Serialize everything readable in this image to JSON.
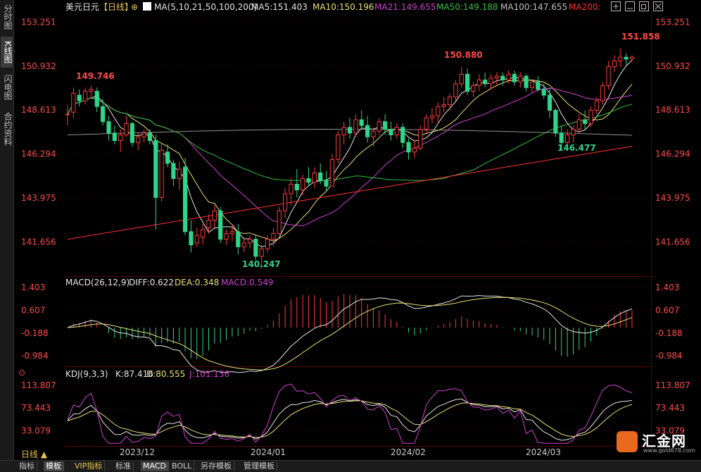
{
  "left_rail": {
    "tabs": [
      {
        "label": "分时图",
        "active": false
      },
      {
        "label": "K线图",
        "active": true
      },
      {
        "label": "闪电图",
        "active": false
      },
      {
        "label": "合约资料",
        "active": false
      }
    ]
  },
  "header": {
    "symbol": "美元日元",
    "period": "【日线】",
    "ma_title": "MA(5,10,21,50,100,200)",
    "ma5": "MA5:151.403",
    "ma10": "MA10:150.196",
    "ma21": "MA21:149.655",
    "ma50": "MA50:149.188",
    "ma100": "MA100:147.655",
    "ma200": "MA200:"
  },
  "window_buttons": [
    "move-icon",
    "minimize-icon",
    "restore-icon",
    "close-icon"
  ],
  "colors": {
    "up": "#ff3b3b",
    "down": "#2fd58a",
    "ma5": "#e6e6e6",
    "ma10": "#e8e070",
    "ma21": "#d040d0",
    "ma50": "#30c040",
    "ma100": "#909090",
    "ma200": "#ff3030",
    "axis_price": "#ff4a4a",
    "grid": "#3a0000"
  },
  "price_panel": {
    "y_ticks": [
      "153.251",
      "150.932",
      "148.613",
      "146.294",
      "143.975",
      "141.656"
    ],
    "annotations": {
      "high_right": "151.858",
      "mid_high": "150.880",
      "early_high": "149.746",
      "low": "140.247",
      "mid_low": "146.477"
    }
  },
  "macd_panel": {
    "title": "MACD(26,12,9)",
    "diff": "DIFF:0.622",
    "dea": "DEA:0.348",
    "macd": "MACD:0.549",
    "y_ticks": [
      "1.403",
      "0.607",
      "-0.188",
      "-0.984"
    ]
  },
  "kdj_panel": {
    "title": "KDJ(9,3,3)",
    "k": "K:87.416",
    "d": "D:80.555",
    "j": "J:101.136",
    "y_ticks": [
      "113.807",
      "73.443",
      "33.079"
    ]
  },
  "x_axis": {
    "labels": [
      "2023/12",
      "2024/01",
      "2024/02",
      "2024/03"
    ]
  },
  "period_label": "日线 ▲",
  "bottom_tabs": [
    {
      "label": "指标",
      "active": false
    },
    {
      "label": "模板",
      "active": true
    },
    {
      "label": "VIP指标",
      "active": false
    },
    {
      "label": "标准",
      "active": false
    },
    {
      "label": "MACD",
      "active": true
    },
    {
      "label": "BOLL",
      "active": false
    },
    {
      "label": "另存模板",
      "active": false
    },
    {
      "label": "管理模板",
      "active": false
    }
  ],
  "logo": {
    "name": "汇金网",
    "sub": "www.gold678.com"
  },
  "chart_data": [
    {
      "type": "candlestick",
      "title": "美元日元【日线】",
      "ylim": [
        140.0,
        153.6
      ],
      "candles": [
        [
          148.4,
          148.9,
          147.8,
          148.4
        ],
        [
          148.5,
          149.8,
          148.2,
          149.5
        ],
        [
          149.4,
          149.7,
          148.8,
          149.1
        ],
        [
          149.1,
          149.8,
          148.9,
          149.6
        ],
        [
          149.6,
          149.9,
          149.2,
          149.7
        ],
        [
          149.6,
          149.8,
          148.5,
          148.8
        ],
        [
          148.8,
          149.2,
          147.8,
          148.0
        ],
        [
          148.0,
          148.3,
          147.0,
          147.4
        ],
        [
          147.4,
          147.8,
          146.8,
          147.0
        ],
        [
          147.0,
          147.6,
          146.4,
          147.3
        ],
        [
          147.3,
          148.3,
          147.2,
          147.9
        ],
        [
          147.9,
          148.0,
          146.7,
          146.9
        ],
        [
          146.9,
          147.4,
          146.5,
          147.2
        ],
        [
          147.2,
          147.6,
          146.9,
          147.4
        ],
        [
          147.4,
          147.6,
          146.8,
          147.0
        ],
        [
          147.0,
          147.3,
          142.3,
          144.0
        ],
        [
          144.0,
          146.9,
          143.8,
          146.5
        ],
        [
          146.4,
          146.8,
          145.6,
          145.8
        ],
        [
          145.8,
          146.0,
          144.6,
          145.0
        ],
        [
          145.0,
          145.9,
          144.4,
          145.5
        ],
        [
          145.6,
          146.1,
          142.0,
          142.2
        ],
        [
          142.2,
          142.8,
          141.1,
          141.5
        ],
        [
          141.6,
          142.4,
          141.4,
          142.0
        ],
        [
          141.9,
          142.6,
          141.5,
          142.3
        ],
        [
          142.4,
          143.1,
          142.1,
          142.8
        ],
        [
          142.8,
          143.6,
          142.4,
          143.3
        ],
        [
          143.3,
          143.5,
          141.6,
          141.8
        ],
        [
          141.8,
          142.3,
          141.5,
          142.1
        ],
        [
          142.1,
          142.6,
          141.7,
          142.2
        ],
        [
          142.2,
          142.6,
          141.0,
          141.4
        ],
        [
          141.4,
          141.9,
          141.1,
          141.6
        ],
        [
          141.6,
          142.0,
          141.3,
          141.8
        ],
        [
          141.8,
          142.0,
          140.7,
          140.9
        ],
        [
          140.9,
          141.5,
          140.25,
          141.3
        ],
        [
          141.3,
          142.0,
          141.1,
          141.8
        ],
        [
          141.8,
          142.4,
          141.4,
          142.1
        ],
        [
          142.1,
          143.5,
          142.0,
          143.3
        ],
        [
          143.3,
          144.5,
          142.9,
          144.2
        ],
        [
          144.2,
          145.0,
          143.6,
          144.7
        ],
        [
          144.7,
          145.5,
          144.0,
          144.4
        ],
        [
          144.4,
          145.2,
          144.1,
          145.0
        ],
        [
          145.0,
          145.6,
          144.6,
          144.8
        ],
        [
          144.8,
          145.6,
          144.5,
          145.3
        ],
        [
          145.3,
          145.8,
          144.7,
          144.9
        ],
        [
          144.9,
          145.4,
          144.3,
          144.6
        ],
        [
          144.6,
          146.3,
          144.6,
          146.0
        ],
        [
          146.0,
          147.5,
          145.8,
          147.3
        ],
        [
          147.3,
          148.0,
          146.8,
          147.7
        ],
        [
          147.7,
          148.2,
          147.1,
          147.4
        ],
        [
          147.4,
          148.4,
          147.2,
          148.1
        ],
        [
          148.1,
          148.6,
          147.6,
          147.8
        ],
        [
          147.8,
          148.3,
          146.9,
          147.2
        ],
        [
          147.2,
          147.7,
          146.7,
          147.5
        ],
        [
          147.5,
          148.2,
          147.3,
          148.0
        ],
        [
          148.0,
          148.4,
          147.3,
          147.6
        ],
        [
          147.6,
          148.0,
          147.0,
          147.3
        ],
        [
          147.3,
          147.9,
          147.1,
          147.7
        ],
        [
          147.7,
          147.9,
          146.6,
          146.9
        ],
        [
          146.9,
          147.1,
          146.0,
          146.4
        ],
        [
          146.4,
          147.0,
          146.1,
          146.6
        ],
        [
          146.6,
          147.8,
          146.5,
          147.6
        ],
        [
          147.6,
          148.4,
          147.4,
          148.2
        ],
        [
          148.2,
          148.7,
          147.9,
          148.3
        ],
        [
          148.3,
          149.0,
          147.9,
          148.8
        ],
        [
          148.8,
          149.3,
          148.5,
          148.9
        ],
        [
          148.9,
          149.5,
          148.6,
          149.3
        ],
        [
          149.3,
          150.2,
          149.1,
          150.0
        ],
        [
          150.0,
          150.88,
          149.8,
          150.5
        ],
        [
          150.5,
          150.8,
          149.4,
          149.6
        ],
        [
          149.6,
          150.1,
          149.3,
          149.9
        ],
        [
          149.9,
          150.5,
          149.6,
          150.2
        ],
        [
          150.2,
          150.6,
          149.8,
          150.0
        ],
        [
          150.0,
          150.5,
          149.7,
          150.3
        ],
        [
          150.3,
          150.6,
          149.9,
          150.4
        ],
        [
          150.4,
          150.6,
          149.9,
          150.2
        ],
        [
          150.2,
          150.7,
          150.0,
          150.5
        ],
        [
          150.5,
          150.7,
          149.9,
          150.1
        ],
        [
          150.1,
          150.6,
          149.8,
          150.4
        ],
        [
          150.4,
          150.5,
          149.6,
          149.8
        ],
        [
          149.8,
          150.2,
          149.5,
          150.1
        ],
        [
          150.1,
          150.4,
          149.6,
          149.7
        ],
        [
          149.7,
          150.0,
          149.2,
          149.4
        ],
        [
          149.4,
          149.8,
          148.2,
          148.6
        ],
        [
          148.6,
          148.7,
          147.2,
          147.4
        ],
        [
          147.4,
          147.8,
          146.48,
          146.9
        ],
        [
          146.9,
          147.6,
          146.6,
          147.3
        ],
        [
          147.3,
          147.8,
          146.9,
          147.6
        ],
        [
          147.6,
          148.4,
          147.4,
          148.1
        ],
        [
          148.1,
          148.6,
          147.6,
          147.9
        ],
        [
          147.9,
          148.8,
          147.7,
          148.6
        ],
        [
          148.6,
          149.3,
          148.4,
          149.1
        ],
        [
          149.1,
          150.1,
          148.9,
          149.9
        ],
        [
          149.9,
          151.2,
          149.7,
          150.9
        ],
        [
          150.9,
          151.5,
          150.6,
          151.2
        ],
        [
          151.2,
          151.86,
          150.9,
          151.4
        ],
        [
          151.4,
          151.6,
          151.0,
          151.3
        ],
        [
          151.3,
          151.5,
          151.2,
          151.4
        ]
      ]
    },
    {
      "type": "bar",
      "title": "MACD(26,12,9)",
      "ylim": [
        -1.25,
        1.6
      ]
    },
    {
      "type": "line",
      "title": "KDJ(9,3,3)",
      "ylim": [
        10,
        125
      ]
    }
  ]
}
